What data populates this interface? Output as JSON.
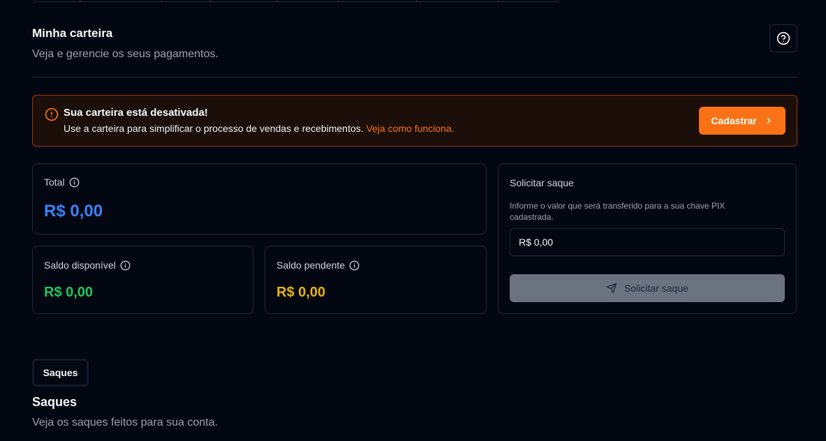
{
  "header": {
    "title": "Minha carteira",
    "subtitle": "Veja e gerencie os seus pagamentos."
  },
  "alert": {
    "title": "Sua carteira está desativada!",
    "text": "Use a carteira para simplificar o processo de vendas e recebimentos.",
    "link": "Veja como funciona.",
    "cta_label": "Cadastrar"
  },
  "balances": {
    "total_label": "Total",
    "total_value": "R$ 0,00",
    "available_label": "Saldo disponível",
    "available_value": "R$ 0,00",
    "pending_label": "Saldo pendente",
    "pending_value": "R$ 0,00"
  },
  "withdraw": {
    "title": "Solicitar saque",
    "description": "Informe o valor que será transferido para a sua chave PIX cadastrada.",
    "input_value": "R$ 0,00",
    "button_label": "Solicitar saque"
  },
  "tabs": [
    {
      "label": "Saques"
    }
  ],
  "section": {
    "title": "Saques",
    "subtitle": "Veja os saques feitos para sua conta."
  },
  "colors": {
    "background": "#030712",
    "accent": "#f97316",
    "total": "#3b82f6",
    "available": "#22c55e",
    "pending": "#eab308",
    "disabled_button": "#6b7280"
  },
  "icons": {
    "help": "help-circle-icon",
    "alert": "alert-circle-icon",
    "info": "info-icon",
    "chevron": "chevron-right-icon",
    "send": "send-icon"
  }
}
